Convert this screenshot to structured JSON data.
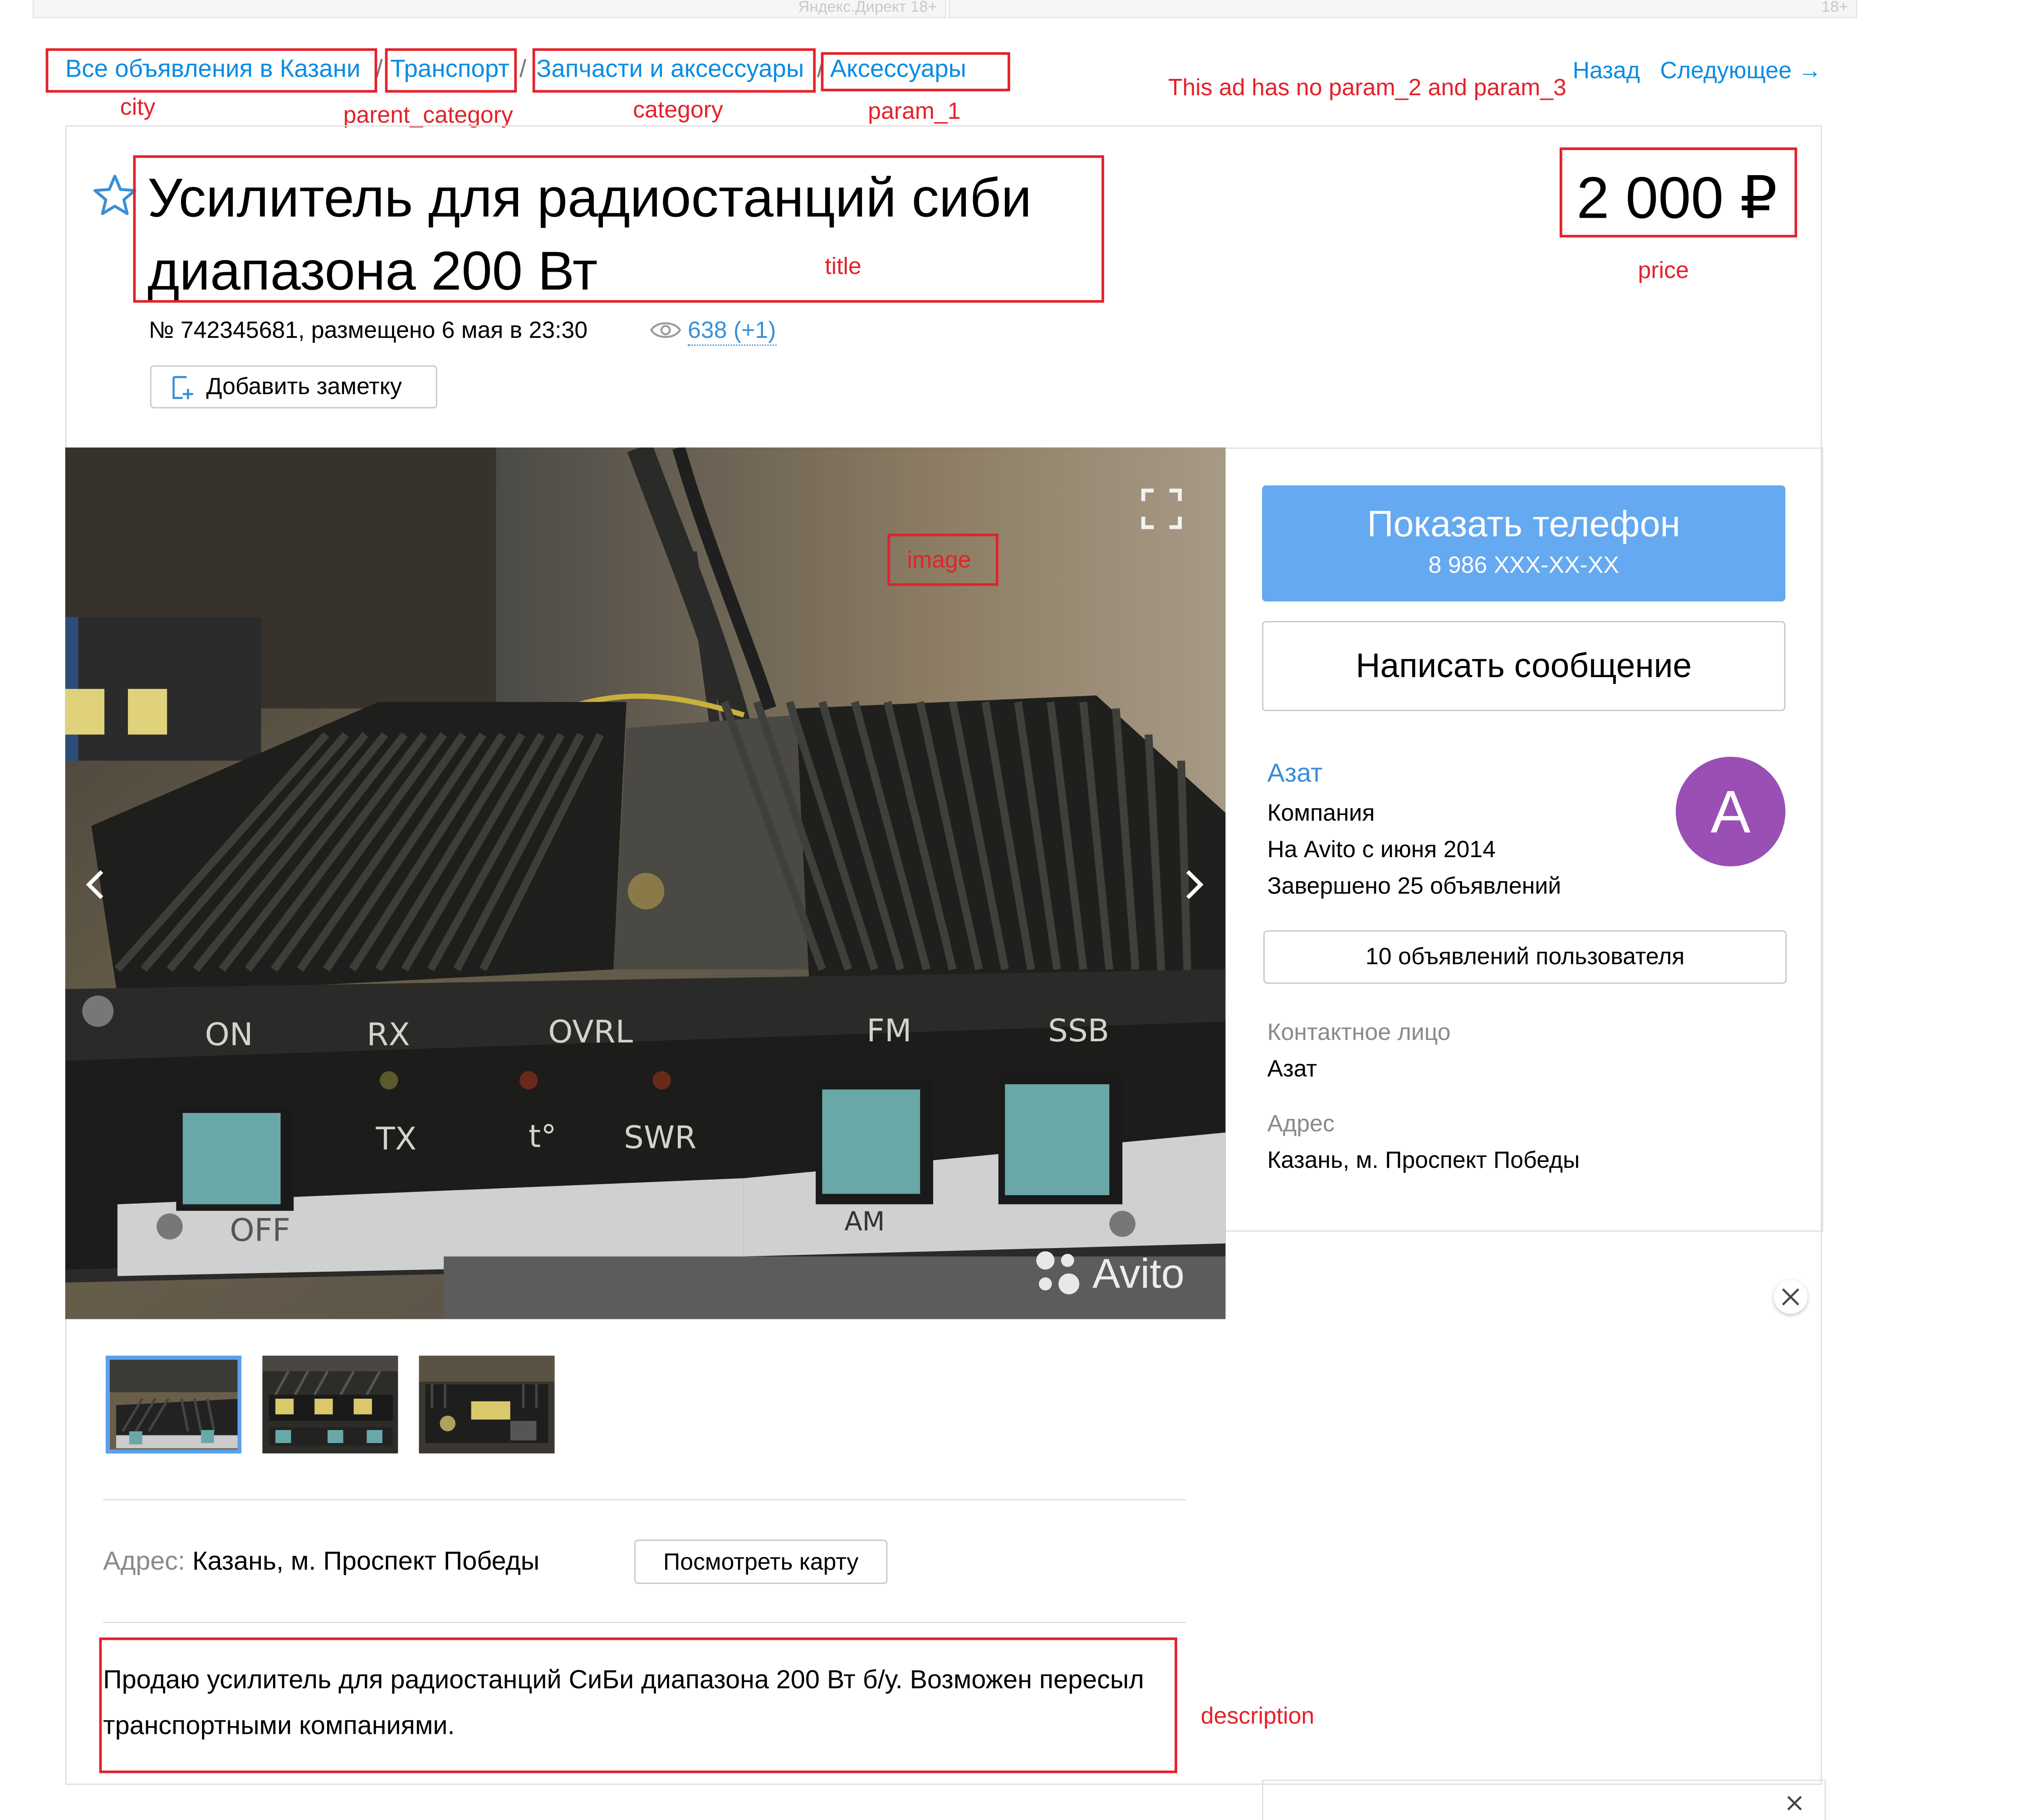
{
  "ad_strip": {
    "left_label": "Яндекс.Директ  18+",
    "right_label": "18+"
  },
  "breadcrumbs": [
    {
      "label": "Все объявления в Казани"
    },
    {
      "label": "Транспорт"
    },
    {
      "label": "Запчасти и аксессуары"
    },
    {
      "label": "Аксессуары"
    }
  ],
  "breadcrumb_separator": "/",
  "nav": {
    "back": "Назад",
    "next": "Следующее →"
  },
  "annotations": {
    "city": "city",
    "parent_category": "parent_category",
    "category": "category",
    "param_1": "param_1",
    "note": "This ad has no param_2 and param_3",
    "title": "title",
    "price": "price",
    "image": "image",
    "description": "description",
    "color": "#e3222b"
  },
  "ad": {
    "title": "Усилитель для радиостанций сиби диапазона 200 Вт",
    "price": "2 000 ₽",
    "meta": "№ 742345681, размещено 6 мая в 23:30",
    "views": "638 (+1)",
    "add_note": "Добавить заметку",
    "description": "Продаю усилитель для радиостанций СиБи диапазона 200 Вт б/у. Возможен пересыл транспортными компаниями."
  },
  "photo": {
    "panel_labels": [
      "ON",
      "RX",
      "OVRL",
      "FM",
      "SSB",
      "TX",
      "t°",
      "SWR",
      "OFF",
      "AM"
    ],
    "watermark": "Avito",
    "thumbnail_count": 3
  },
  "contact": {
    "show_phone": "Показать телефон",
    "phone_masked": "8 986 XXX-XX-XX",
    "write_message": "Написать сообщение",
    "seller_name": "Азат",
    "seller_type": "Компания",
    "since": "На Avito с июня 2014",
    "completed": "Завершено 25 объявлений",
    "avatar_letter": "A",
    "all_ads": "10 объявлений пользователя",
    "contact_person_label": "Контактное лицо",
    "contact_person": "Азат",
    "address_label": "Адрес",
    "address": "Казань, м. Проспект Победы"
  },
  "address_row": {
    "label": "Адрес:",
    "value": "Казань, м. Проспект Победы",
    "map_button": "Посмотреть карту"
  },
  "colors": {
    "link": "#0b8ce3",
    "phone_button": "#65a9f0",
    "avatar": "#9a4fb5"
  }
}
